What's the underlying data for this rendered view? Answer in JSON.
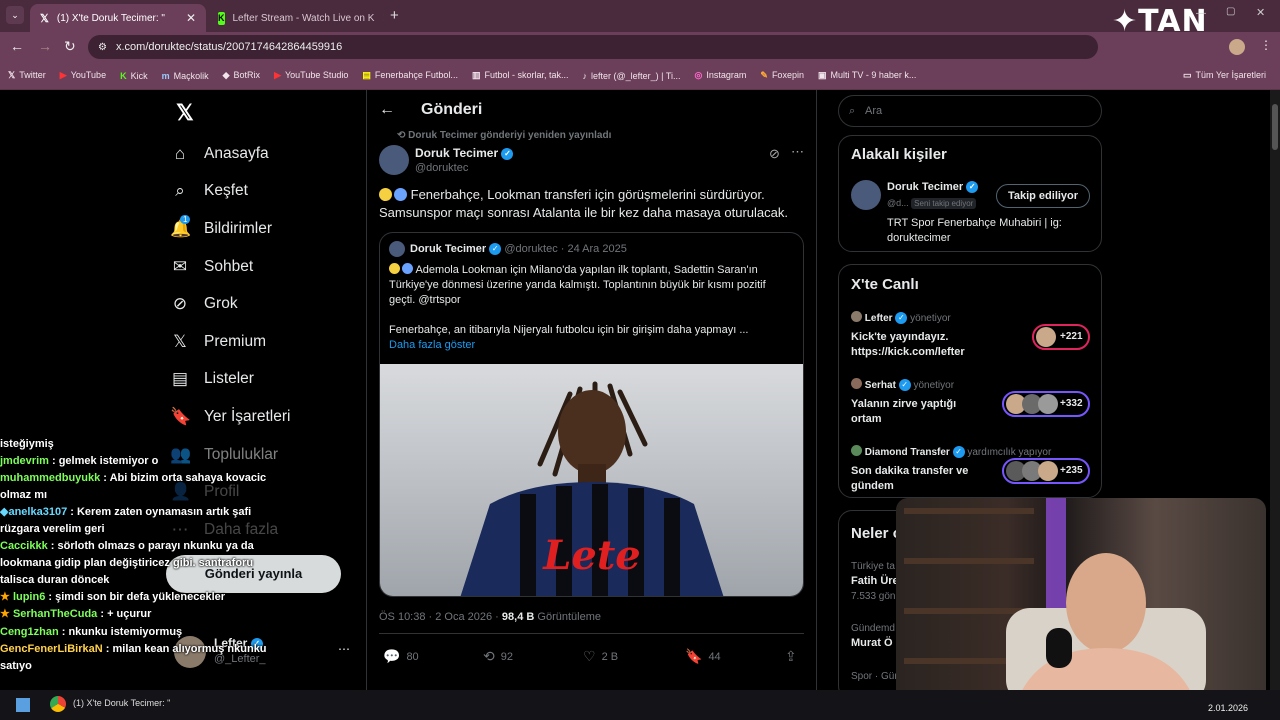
{
  "browser": {
    "tabs": [
      {
        "title": "(1) X'te Doruk Tecimer: \"",
        "icon": "x-logo"
      },
      {
        "title": "Lefter Stream - Watch Live on K",
        "icon": "kick-logo"
      }
    ],
    "url": "x.com/doruktec/status/2007174642864459916",
    "bookmarks": [
      "Twitter",
      "YouTube",
      "Kick",
      "Maçkolik",
      "BotRix",
      "YouTube Studio",
      "Fenerbahçe Futbol...",
      "Futbol - skorlar, tak...",
      "lefter (@_lefter_) | Ti...",
      "Instagram",
      "Foxepin",
      "Multi TV - 9 haber k..."
    ],
    "all_bookmarks": "Tüm Yer İşaretleri",
    "watermark": "TAN"
  },
  "nav": {
    "items": [
      "Anasayfa",
      "Keşfet",
      "Bildirimler",
      "Sohbet",
      "Grok",
      "Premium",
      "Listeler",
      "Yer İşaretleri",
      "Topluluklar",
      "Profil",
      "Daha fazla"
    ],
    "notif_badge": "1",
    "post_button": "Gönderi yayınla",
    "account": {
      "name": "Lefter",
      "handle": "@_Lefter_"
    }
  },
  "post": {
    "header": "Gönderi",
    "repost_note": "Doruk Tecimer gönderiyi yeniden yayınladı",
    "author": "Doruk Tecimer",
    "handle": "@doruktec",
    "text_line1": "Fenerbahçe, Lookman transferi için görüşmelerini sürdürüyor.",
    "text_line2": "Samsunspor maçı sonrası Atalanta ile bir kez daha masaya oturulacak.",
    "quote": {
      "author": "Doruk Tecimer",
      "handle": "@doruktec",
      "date": "24 Ara 2025",
      "line1": "Ademola Lookman için Milano'da yapılan ilk toplantı, Sadettin Saran'ın",
      "line2": "Türkiye'ye dönmesi üzerine yarıda kalmıştı. Toplantının büyük bir kısmı pozitif",
      "line3": "geçti. @trtspor",
      "line4": "Fenerbahçe, an itibarıyla Nijeryalı futbolcu için bir girişim daha yapmayı ...",
      "show_more": "Daha fazla göster",
      "jersey_sponsor": "Lete"
    },
    "time": "ÖS 10:38 · 2 Oca 2026 · ",
    "views": "98,4 B",
    "views_label": "Görüntüleme",
    "replies": "80",
    "reposts": "92",
    "likes": "2 B",
    "bookmarks": "44"
  },
  "right": {
    "search_placeholder": "Ara",
    "related_title": "Alakalı kişiler",
    "related": {
      "name": "Doruk Tecimer",
      "handle": "@d...",
      "follows_you": "Seni takip ediyor",
      "button": "Takip ediliyor",
      "bio": "TRT Spor Fenerbahçe Muhabiri | ig: doruktecimer"
    },
    "live_title": "X'te Canlı",
    "live": [
      {
        "host": "Lefter",
        "role": "yönetiyor",
        "title1": "Kick'te yayındayız.",
        "title2": "https://kick.com/lefter",
        "count": "+221"
      },
      {
        "host": "Serhat",
        "role": "yönetiyor",
        "title1": "Yalanın zirve yaptığı",
        "title2": "ortam",
        "count": "+332"
      },
      {
        "host": "Diamond Transfer",
        "role": "yardımcılık yapıyor",
        "title1": "Son dakika transfer ve",
        "title2": "gündem",
        "count": "+235"
      }
    ],
    "trends_title": "Neler o",
    "trends": [
      {
        "cat": "Türkiye ta",
        "name": "Fatih Üre",
        "count": "7.533 gön"
      },
      {
        "cat": "Gündemd",
        "name": "Murat Ö",
        "count": ""
      },
      {
        "cat": "Spor · Gün",
        "name": "",
        "count": ""
      }
    ]
  },
  "chat": [
    {
      "user": "",
      "msg": "isteğiymiş",
      "color": "#ffffff"
    },
    {
      "user": "jmdevrim",
      "msg": " : gelmek istemiyor o",
      "color": "#7dff5a"
    },
    {
      "user": "muhammedbuyukk",
      "msg": " : Abi bizim orta sahaya kovacic olmaz mı",
      "color": "#7dff5a"
    },
    {
      "user": "anelka3107",
      "msg": " : Kerem zaten oynamasın artık şafi rüzgara verelim geri",
      "color": "#66d9ff"
    },
    {
      "user": "Caccikkk",
      "msg": " : sörloth olmazs o parayı nkunku ya da lookmana gidip plan değiştiricez gibi. santraforu talisca duran döncek",
      "color": "#7dff5a"
    },
    {
      "user": "lupin6",
      "msg": " : şimdi son bir defa yüklenecekler",
      "color": "#7dff5a"
    },
    {
      "user": "SerhanTheCuda",
      "msg": " : + uçurur",
      "color": "#7dff5a"
    },
    {
      "user": "Ceng1zhan",
      "msg": " : nkunku istemiyormuş",
      "color": "#7dff5a"
    },
    {
      "user": "GencFenerLiBirkaN",
      "msg": " : milan kean alıyormuş nkunku satıyo",
      "color": "#ffd24d"
    }
  ],
  "taskbar": {
    "window": "(1) X'te Doruk Tecimer: \"",
    "date": "2.01.2026"
  }
}
